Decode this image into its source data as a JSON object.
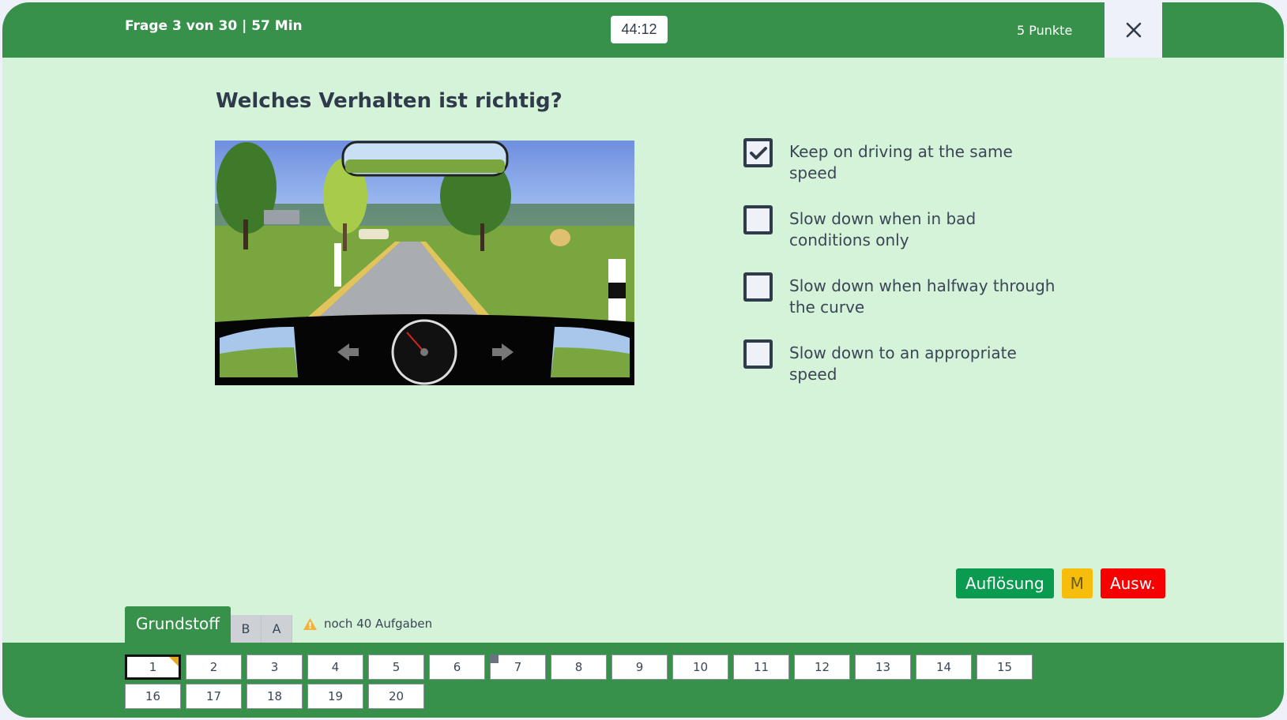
{
  "header": {
    "title": "Frage 3 von 30 | 57 Min",
    "timer": "44:12",
    "points": "5 Punkte",
    "close_icon": "close-icon"
  },
  "question": {
    "text": "Welches Verhalten ist richtig?",
    "image": "driving-scene-curve-with-dashboard",
    "answers": [
      {
        "text": "Keep on driving at the same speed",
        "checked": true
      },
      {
        "text": "Slow down when in bad conditions only",
        "checked": false
      },
      {
        "text": "Slow down when halfway through the curve",
        "checked": false
      },
      {
        "text": "Slow down to an appropriate speed",
        "checked": false
      }
    ]
  },
  "actions": {
    "solution": "Auflösung",
    "mark": "M",
    "evaluate": "Ausw."
  },
  "tabs": {
    "main": "Grundstoff",
    "b": "B",
    "a": "A"
  },
  "warning": {
    "icon": "warning-icon",
    "text": "noch 40 Aufgaben"
  },
  "navigator": {
    "items": [
      "1",
      "2",
      "3",
      "4",
      "5",
      "6",
      "7",
      "8",
      "9",
      "10",
      "11",
      "12",
      "13",
      "14",
      "15",
      "16",
      "17",
      "18",
      "19",
      "20"
    ],
    "current": "1",
    "marked_corner": "1",
    "flagged": "7"
  },
  "colors": {
    "primary_green": "#37914b",
    "background": "#d4f3d9",
    "solution_green": "#0a9b50",
    "mark_yellow": "#f6bd0c",
    "evaluate_red": "#f70000"
  }
}
